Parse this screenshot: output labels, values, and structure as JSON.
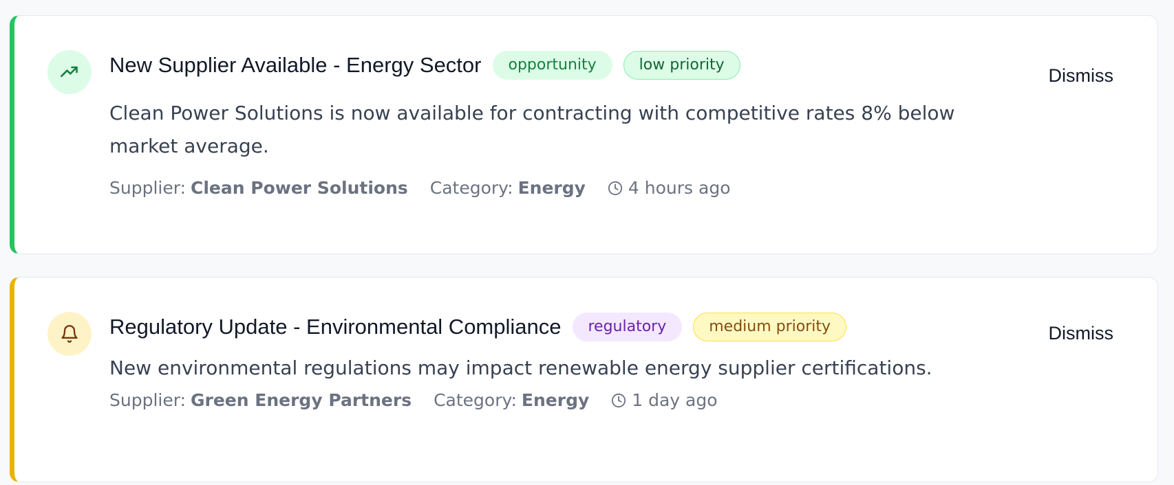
{
  "alerts": [
    {
      "icon": "trending-up-icon",
      "title": "New Supplier Available - Energy Sector",
      "type_badge": "opportunity",
      "priority_badge": "low priority",
      "description": "Clean Power Solutions is now available for contracting with competitive rates 8% below market average.",
      "supplier_label": "Supplier:",
      "supplier": "Clean Power Solutions",
      "category_label": "Category:",
      "category": "Energy",
      "time": "4 hours ago",
      "dismiss_label": "Dismiss",
      "accent_color": "#22c55e"
    },
    {
      "icon": "bell-icon",
      "title": "Regulatory Update - Environmental Compliance",
      "type_badge": "regulatory",
      "priority_badge": "medium priority",
      "description": "New environmental regulations may impact renewable energy supplier certifications.",
      "supplier_label": "Supplier:",
      "supplier": "Green Energy Partners",
      "category_label": "Category:",
      "category": "Energy",
      "time": "1 day ago",
      "dismiss_label": "Dismiss",
      "accent_color": "#eab308"
    }
  ]
}
